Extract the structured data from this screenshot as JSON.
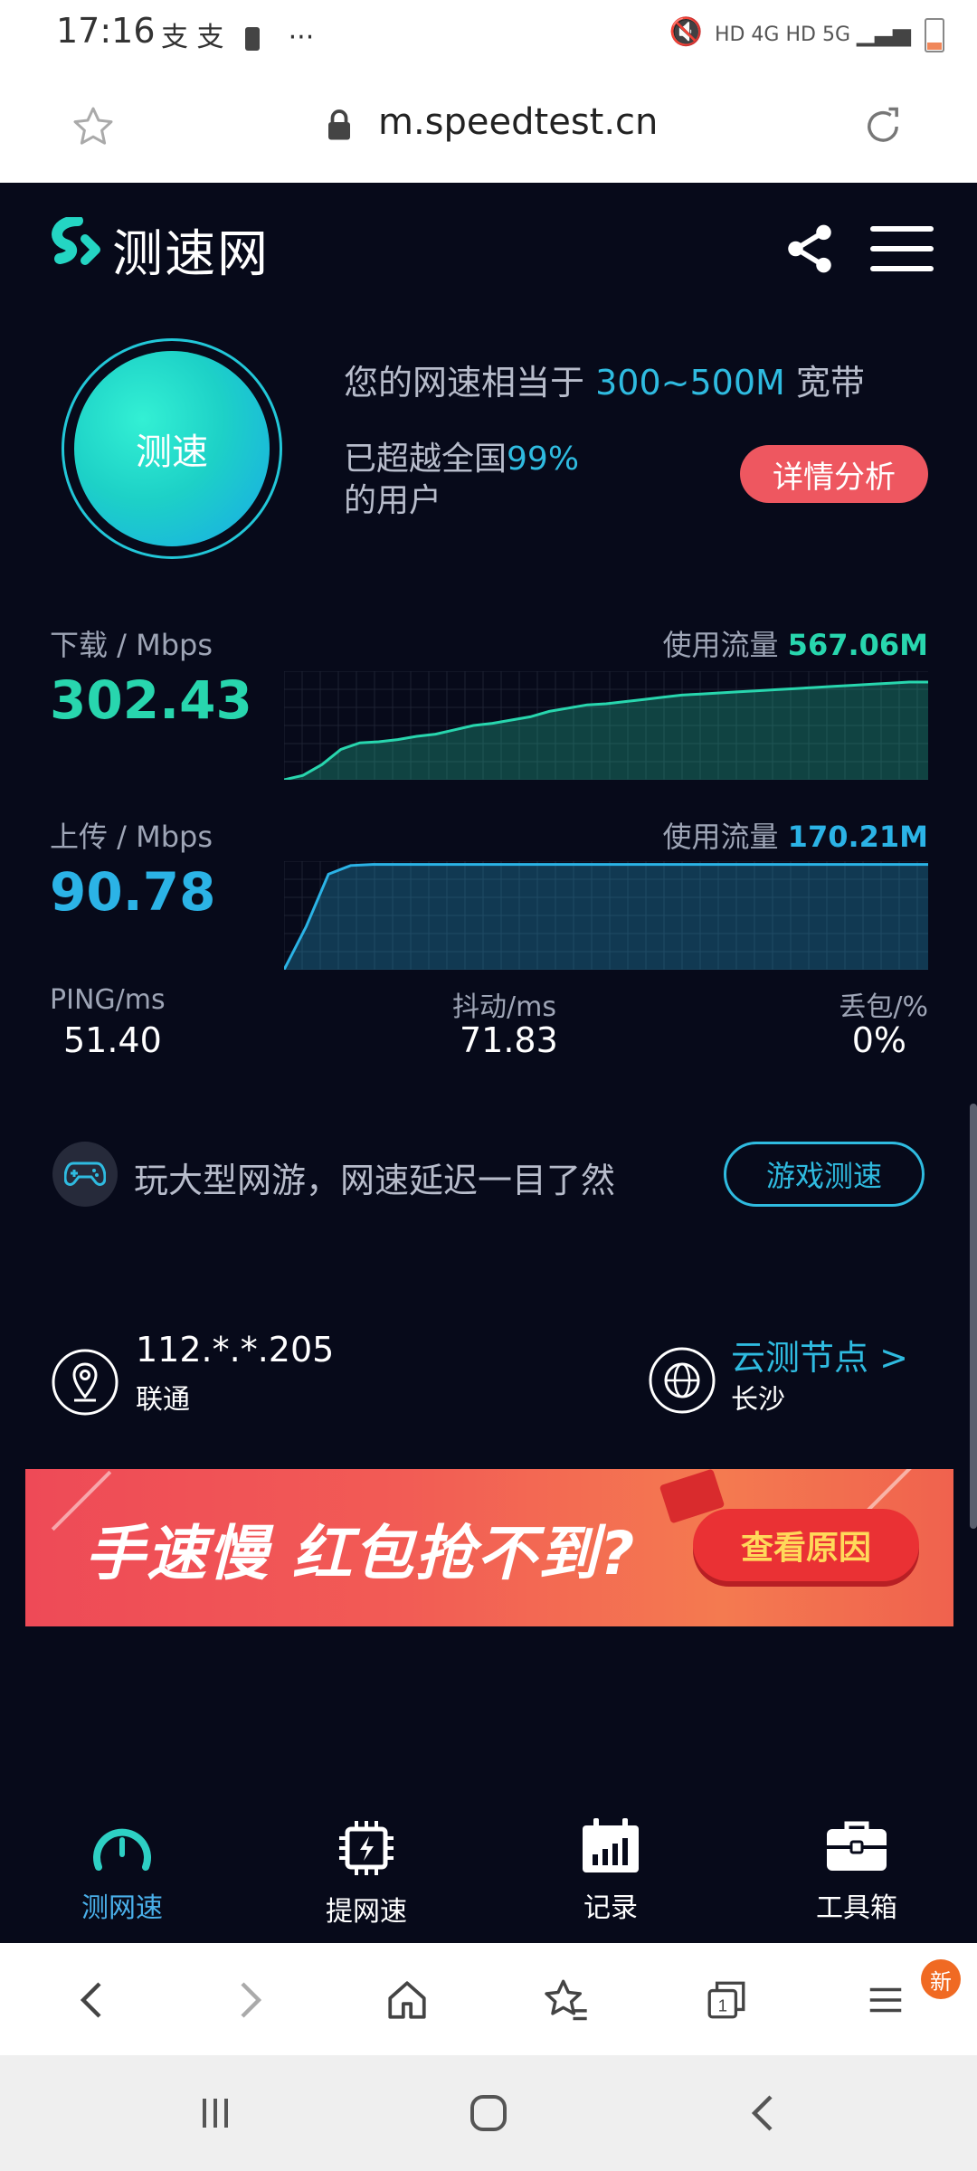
{
  "status_bar": {
    "time": "17:16",
    "left_icons": "支 支",
    "more": "···",
    "right_labels": "HD 4G HD 5G"
  },
  "browser": {
    "url": "m.speedtest.cn"
  },
  "app": {
    "logo_text": "测速网",
    "test_button": "测速",
    "equiv_prefix": "您的网速相当于 ",
    "equiv_value": "300~500M",
    "equiv_suffix": " 宽带",
    "beat_prefix": "已超越全国",
    "beat_value": "99%",
    "beat_suffix": "的用户",
    "detail_button": "详情分析"
  },
  "download": {
    "label": "下载 / Mbps",
    "value": "302.43",
    "usage_label": "使用流量 ",
    "usage_value": "567.06M",
    "series": [
      0,
      4,
      14,
      28,
      34,
      35,
      37,
      40,
      42,
      46,
      50,
      52,
      55,
      58,
      63,
      66,
      69,
      70,
      72,
      74,
      76,
      78,
      79,
      80,
      81,
      82,
      83,
      84,
      85,
      86,
      87,
      88,
      89,
      90,
      90
    ]
  },
  "upload": {
    "label": "上传 / Mbps",
    "value": "90.78",
    "usage_label": "使用流量 ",
    "usage_value": "170.21M",
    "series": [
      0,
      40,
      88,
      96,
      97,
      97,
      97,
      97,
      97,
      97,
      97,
      97,
      97,
      97,
      97,
      97,
      97,
      97,
      97,
      97,
      97,
      97,
      97,
      97,
      97,
      97,
      97,
      97,
      97,
      97
    ]
  },
  "stats": {
    "ping_label": "PING/ms",
    "ping_value": "51.40",
    "jitter_label": "抖动/ms",
    "jitter_value": "71.83",
    "loss_label": "丢包/%",
    "loss_value": "0%"
  },
  "game": {
    "text": "玩大型网游，网速延迟一目了然",
    "button": "游戏测速"
  },
  "network": {
    "ip": "112.*.*.205",
    "isp": "联通",
    "node_link": "云测节点 >",
    "node_city": "长沙"
  },
  "banner": {
    "text": "手速慢 红包抢不到?",
    "button": "查看原因"
  },
  "nav": {
    "speed": "测网速",
    "boost": "提网速",
    "records": "记录",
    "tools": "工具箱"
  },
  "browser_bar": {
    "badge": "新"
  },
  "colors": {
    "background": "#070a1a",
    "download": "#28d6ae",
    "upload": "#2bb3e6",
    "detail_button": "#ee5760",
    "banner": "#f25b55"
  }
}
